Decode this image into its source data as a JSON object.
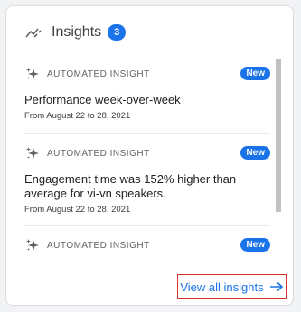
{
  "header": {
    "title": "Insights",
    "count": "3",
    "icon": "trending-icon"
  },
  "insights": [
    {
      "label": "AUTOMATED INSIGHT",
      "badge": "New",
      "title": "Performance week-over-week",
      "date": "From August 22 to 28, 2021"
    },
    {
      "label": "AUTOMATED INSIGHT",
      "badge": "New",
      "title": "Engagement time was 152% higher than average for vi-vn speakers.",
      "date": "From August 22 to 28, 2021"
    },
    {
      "label": "AUTOMATED INSIGHT",
      "badge": "New",
      "title": "",
      "date": ""
    }
  ],
  "footer": {
    "view_all_label": "View all insights",
    "arrow_icon": "arrow-right-icon"
  },
  "colors": {
    "accent": "#1a73e8",
    "highlight_border": "#d93025"
  }
}
